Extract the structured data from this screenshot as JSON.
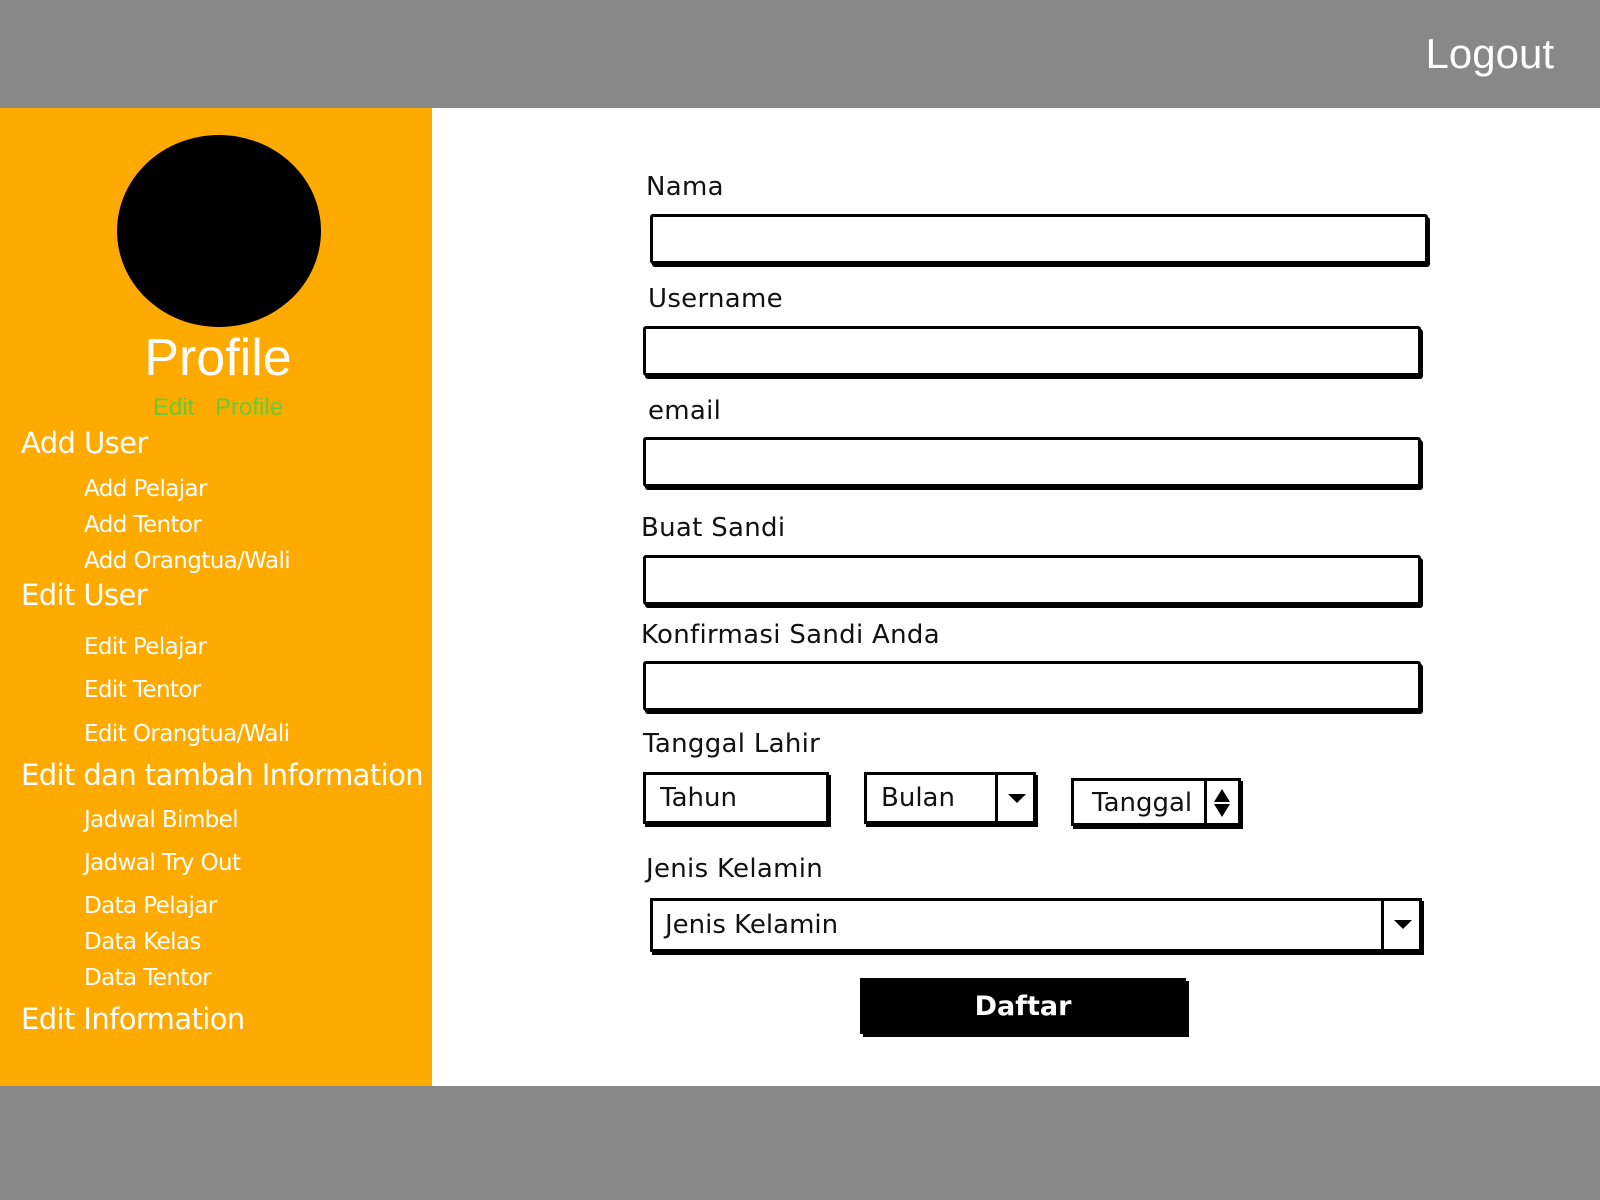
{
  "header": {
    "logout_label": "Logout"
  },
  "sidebar": {
    "profile_title": "Profile",
    "edit_profile_label": "Edit Profile",
    "sections": [
      {
        "heading": "Add User",
        "items": [
          "Add Pelajar",
          "Add Tentor",
          "Add Orangtua/Wali"
        ]
      },
      {
        "heading": "Edit User",
        "items": [
          "Edit Pelajar",
          "Edit Tentor",
          "Edit Orangtua/Wali"
        ]
      },
      {
        "heading": "Edit dan tambah Information",
        "items": [
          "Jadwal Bimbel",
          "Jadwal Try Out",
          "Data Pelajar",
          "Data Kelas",
          "Data Tentor"
        ]
      },
      {
        "heading": "Edit Information",
        "items": []
      }
    ]
  },
  "form": {
    "nama_label": "Nama",
    "nama_value": "",
    "username_label": "Username",
    "username_value": "",
    "email_label": "email",
    "email_value": "",
    "sandi_label": "Buat Sandi",
    "sandi_value": "",
    "konfirmasi_label": "Konfirmasi Sandi Anda",
    "konfirmasi_value": "",
    "tanggal_lahir_label": "Tanggal Lahir",
    "tahun_value": "Tahun",
    "bulan_value": "Bulan",
    "tanggal_value": "Tanggal",
    "jenis_kelamin_label": "Jenis Kelamin",
    "jenis_kelamin_value": "Jenis Kelamin",
    "submit_label": "Daftar"
  },
  "colors": {
    "topbar": "#888888",
    "sidebar": "#ffaa00",
    "edit_profile_link": "#66cc33",
    "button": "#000000"
  }
}
